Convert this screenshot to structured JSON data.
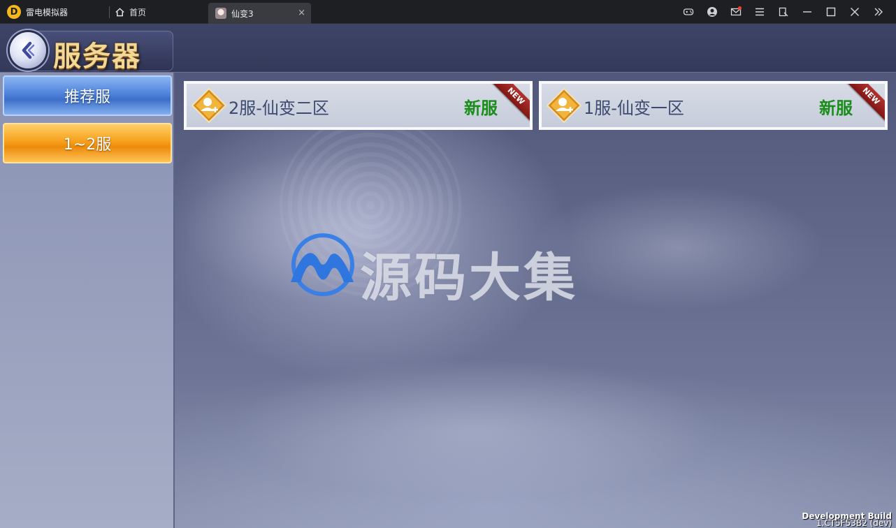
{
  "emulator": {
    "app_name": "雷电模拟器",
    "home_tab": "首页",
    "game_tab": "仙变3",
    "tab_close_glyph": "×",
    "controls": [
      "gamepad-icon",
      "account-icon",
      "mail-icon",
      "menu-icon",
      "resize-icon",
      "minimize-icon",
      "maximize-icon",
      "close-icon",
      "expand-icon"
    ]
  },
  "game": {
    "page_title": "服务器",
    "sidebar": {
      "items": [
        {
          "label": "推荐服",
          "state": "selected"
        },
        {
          "label": "1~2服",
          "state": "normal"
        }
      ]
    },
    "servers": [
      {
        "name": "2服-仙变二区",
        "status": "新服",
        "ribbon": "NEW"
      },
      {
        "name": "1服-仙变一区",
        "status": "新服",
        "ribbon": "NEW"
      }
    ],
    "watermark": "源码大集",
    "build": {
      "label": "Development Build",
      "version": "1.CT5F53B2 (dev)"
    }
  },
  "colors": {
    "accent_blue": "#4f83db",
    "accent_orange": "#f6a11c",
    "status_green": "#1b8d1b",
    "ribbon_red": "#9a2320",
    "title_gold": "#f3d795"
  }
}
